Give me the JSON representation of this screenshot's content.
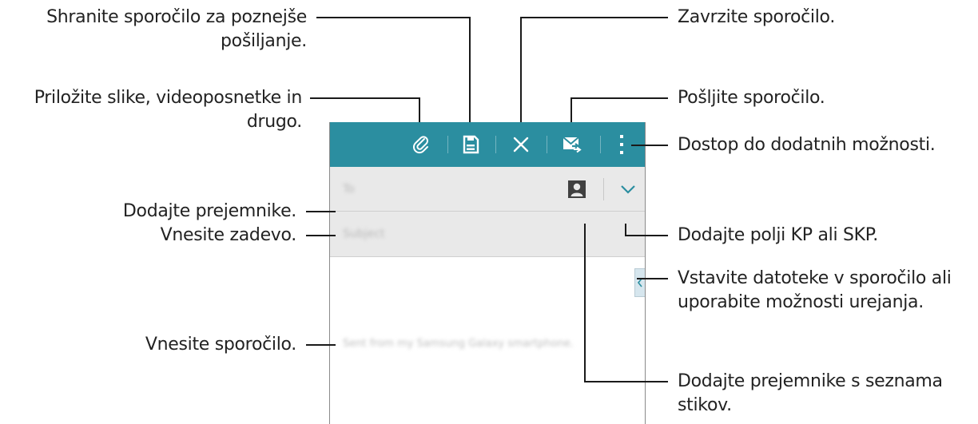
{
  "toolbar": {
    "color": "#2b8ea0",
    "icons": [
      "paperclip-icon",
      "save-icon",
      "close-icon",
      "send-icon",
      "overflow-menu-icon"
    ]
  },
  "compose": {
    "to_placeholder": "To",
    "subject_placeholder": "Subject",
    "body_text": "Sent from my Samsung Galaxy smartphone."
  },
  "callouts": {
    "save_draft": "Shranite sporočilo za poznejše pošiljanje.",
    "save_draft_line1": "Shranite sporočilo za poznejše",
    "save_draft_line2": "pošiljanje.",
    "attach_line1": "Priložite slike, videoposnetke in",
    "attach_line2": "drugo.",
    "add_recipients": "Dodajte prejemnike.",
    "enter_subject": "Vnesite zadevo.",
    "enter_message": "Vnesite sporočilo.",
    "discard": "Zavrzite sporočilo.",
    "send": "Pošljite sporočilo.",
    "more_options": "Dostop do dodatnih možnosti.",
    "add_cc_bcc": "Dodajte polji KP ali SKP.",
    "insert_line1": "Vstavite datoteke v sporočilo ali",
    "insert_line2": "uporabite možnosti urejanja.",
    "contacts_line1": "Dodajte prejemnike s seznama",
    "contacts_line2": "stikov."
  }
}
